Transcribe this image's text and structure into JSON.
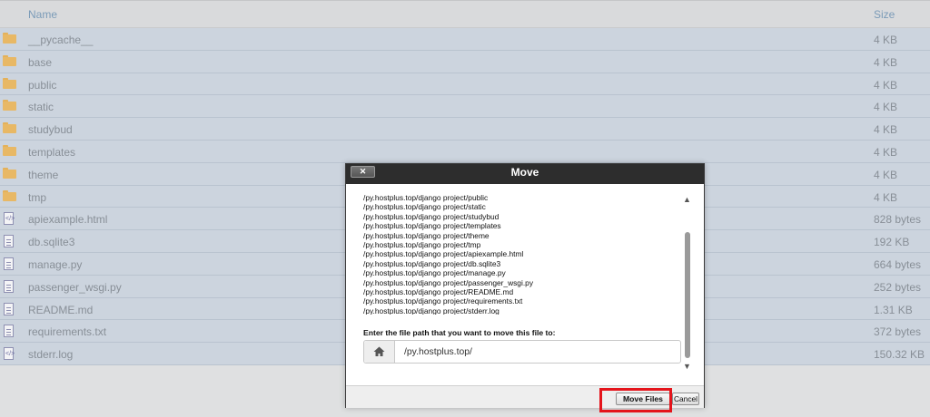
{
  "file_list": {
    "columns": {
      "name": "Name",
      "size": "Size"
    },
    "rows": [
      {
        "name": "__pycache__",
        "size": "4 KB",
        "icon": "folder-icon"
      },
      {
        "name": "base",
        "size": "4 KB",
        "icon": "folder-icon"
      },
      {
        "name": "public",
        "size": "4 KB",
        "icon": "folder-icon"
      },
      {
        "name": "static",
        "size": "4 KB",
        "icon": "folder-icon"
      },
      {
        "name": "studybud",
        "size": "4 KB",
        "icon": "folder-icon"
      },
      {
        "name": "templates",
        "size": "4 KB",
        "icon": "folder-icon"
      },
      {
        "name": "theme",
        "size": "4 KB",
        "icon": "folder-icon"
      },
      {
        "name": "tmp",
        "size": "4 KB",
        "icon": "folder-icon"
      },
      {
        "name": "apiexample.html",
        "size": "828 bytes",
        "icon": "html-file-icon"
      },
      {
        "name": "db.sqlite3",
        "size": "192 KB",
        "icon": "file-icon"
      },
      {
        "name": "manage.py",
        "size": "664 bytes",
        "icon": "file-icon"
      },
      {
        "name": "passenger_wsgi.py",
        "size": "252 bytes",
        "icon": "file-icon"
      },
      {
        "name": "README.md",
        "size": "1.31 KB",
        "icon": "file-icon"
      },
      {
        "name": "requirements.txt",
        "size": "372 bytes",
        "icon": "file-icon"
      },
      {
        "name": "stderr.log",
        "size": "150.32 KB",
        "icon": "html-file-icon"
      }
    ]
  },
  "dialog": {
    "title": "Move",
    "close_label": "✕",
    "paths": [
      "/py.hostplus.top/django project/public",
      "/py.hostplus.top/django project/static",
      "/py.hostplus.top/django project/studybud",
      "/py.hostplus.top/django project/templates",
      "/py.hostplus.top/django project/theme",
      "/py.hostplus.top/django project/tmp",
      "/py.hostplus.top/django project/apiexample.html",
      "/py.hostplus.top/django project/db.sqlite3",
      "/py.hostplus.top/django project/manage.py",
      "/py.hostplus.top/django project/passenger_wsgi.py",
      "/py.hostplus.top/django project/README.md",
      "/py.hostplus.top/django project/requirements.txt",
      "/py.hostplus.top/django project/stderr.log"
    ],
    "prompt": "Enter the file path that you want to move this file to:",
    "path_value": "/py.hostplus.top/",
    "move_label": "Move Files",
    "cancel_label": "Cancel"
  },
  "colors": {
    "highlight": "#e4141b",
    "row_background": "#ccd4de",
    "folder": "#e8b865",
    "title_bar": "#2d2d2d"
  }
}
